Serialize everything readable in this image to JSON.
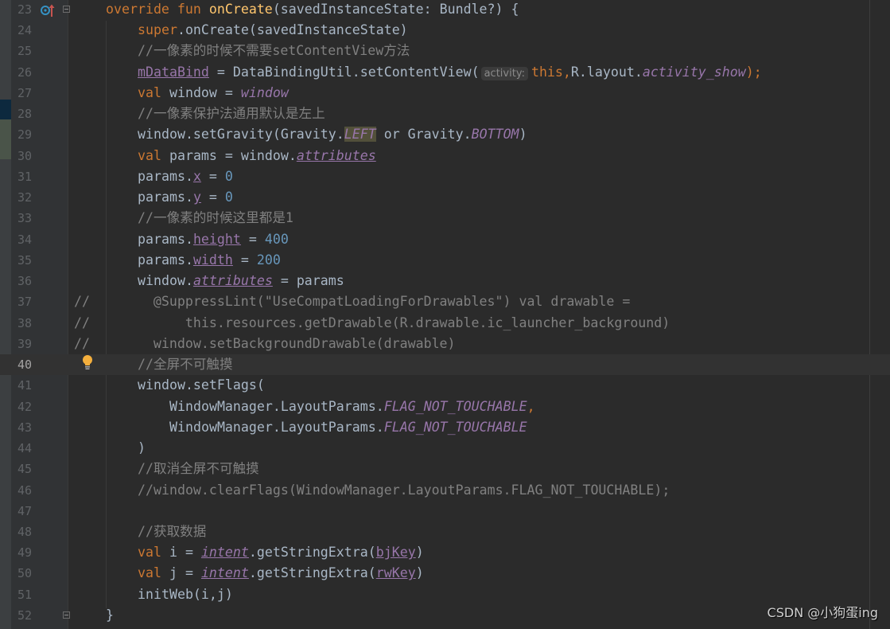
{
  "editor": {
    "colors": {
      "background": "#2b2b2b",
      "gutter": "#313335",
      "keyword": "#cc7832",
      "identifier": "#a9b7c6",
      "comment": "#808080",
      "number": "#6897bb",
      "property": "#9876aa"
    },
    "current_line": 40,
    "lines": [
      {
        "num": "23",
        "indent": 4,
        "tokens": [
          {
            "t": "override fun ",
            "c": "k"
          },
          {
            "t": "onCreate",
            "c": "fn"
          },
          {
            "t": "(savedInstanceState: Bundle?) {",
            "c": "p"
          }
        ]
      },
      {
        "num": "24",
        "indent": 8,
        "tokens": [
          {
            "t": "super",
            "c": "k"
          },
          {
            "t": ".onCreate(savedInstanceState)",
            "c": "p"
          }
        ]
      },
      {
        "num": "25",
        "indent": 8,
        "tokens": [
          {
            "t": "//一像素的时候不需要setContentView方法",
            "c": "c"
          }
        ]
      },
      {
        "num": "26",
        "indent": 8,
        "tokens": [
          {
            "t": "mDataBind",
            "c": "vu"
          },
          {
            "t": " = DataBindingUtil.setContentView(",
            "c": "p"
          },
          {
            "t": "activity:",
            "c": "hint"
          },
          {
            "t": "this,",
            "c": "k"
          },
          {
            "t": "R.layout.",
            "c": "p"
          },
          {
            "t": "activity_show",
            "c": "vi"
          },
          {
            "t": ");",
            "c": "k"
          }
        ]
      },
      {
        "num": "27",
        "indent": 8,
        "tokens": [
          {
            "t": "val ",
            "c": "k"
          },
          {
            "t": "window = ",
            "c": "p"
          },
          {
            "t": "window",
            "c": "vi"
          }
        ]
      },
      {
        "num": "28",
        "indent": 8,
        "tokens": [
          {
            "t": "//一像素保护法通用默认是左上",
            "c": "c"
          }
        ]
      },
      {
        "num": "29",
        "indent": 8,
        "tokens": [
          {
            "t": "window.setGravity(Gravity.",
            "c": "p"
          },
          {
            "t": "LEFT",
            "c": "hl"
          },
          {
            "t": " or Gravity.",
            "c": "p"
          },
          {
            "t": "BOTTOM",
            "c": "vi"
          },
          {
            "t": ")",
            "c": "p"
          }
        ]
      },
      {
        "num": "30",
        "indent": 8,
        "tokens": [
          {
            "t": "val ",
            "c": "k"
          },
          {
            "t": "params = window.",
            "c": "p"
          },
          {
            "t": "attributes",
            "c": "viu"
          }
        ]
      },
      {
        "num": "31",
        "indent": 8,
        "tokens": [
          {
            "t": "params.",
            "c": "p"
          },
          {
            "t": "x",
            "c": "vu"
          },
          {
            "t": " = ",
            "c": "p"
          },
          {
            "t": "0",
            "c": "n"
          }
        ]
      },
      {
        "num": "32",
        "indent": 8,
        "tokens": [
          {
            "t": "params.",
            "c": "p"
          },
          {
            "t": "y",
            "c": "vu"
          },
          {
            "t": " = ",
            "c": "p"
          },
          {
            "t": "0",
            "c": "n"
          }
        ]
      },
      {
        "num": "33",
        "indent": 8,
        "tokens": [
          {
            "t": "//一像素的时候这里都是1",
            "c": "c"
          }
        ]
      },
      {
        "num": "34",
        "indent": 8,
        "tokens": [
          {
            "t": "params.",
            "c": "p"
          },
          {
            "t": "height",
            "c": "vu"
          },
          {
            "t": " = ",
            "c": "p"
          },
          {
            "t": "400",
            "c": "n"
          }
        ]
      },
      {
        "num": "35",
        "indent": 8,
        "tokens": [
          {
            "t": "params.",
            "c": "p"
          },
          {
            "t": "width",
            "c": "vu"
          },
          {
            "t": " = ",
            "c": "p"
          },
          {
            "t": "200",
            "c": "n"
          }
        ]
      },
      {
        "num": "36",
        "indent": 8,
        "tokens": [
          {
            "t": "window.",
            "c": "p"
          },
          {
            "t": "attributes",
            "c": "viu"
          },
          {
            "t": " = params",
            "c": "p"
          }
        ]
      },
      {
        "num": "37",
        "indent": 0,
        "tokens": [
          {
            "t": "//        @SuppressLint(\"UseCompatLoadingForDrawables\") val drawable =",
            "c": "c"
          }
        ]
      },
      {
        "num": "38",
        "indent": 0,
        "tokens": [
          {
            "t": "//            this.resources.getDrawable(R.drawable.ic_launcher_background)",
            "c": "c"
          }
        ]
      },
      {
        "num": "39",
        "indent": 0,
        "tokens": [
          {
            "t": "//        window.setBackgroundDrawable(drawable)",
            "c": "c"
          }
        ]
      },
      {
        "num": "40",
        "indent": 8,
        "tokens": [
          {
            "t": "//全屏不可触摸",
            "c": "c"
          }
        ]
      },
      {
        "num": "41",
        "indent": 8,
        "tokens": [
          {
            "t": "window.setFlags(",
            "c": "p"
          }
        ]
      },
      {
        "num": "42",
        "indent": 12,
        "tokens": [
          {
            "t": "WindowManager.LayoutParams.",
            "c": "p"
          },
          {
            "t": "FLAG_NOT_TOUCHABLE",
            "c": "vi"
          },
          {
            "t": ",",
            "c": "k"
          }
        ]
      },
      {
        "num": "43",
        "indent": 12,
        "tokens": [
          {
            "t": "WindowManager.LayoutParams.",
            "c": "p"
          },
          {
            "t": "FLAG_NOT_TOUCHABLE",
            "c": "vi"
          }
        ]
      },
      {
        "num": "44",
        "indent": 8,
        "tokens": [
          {
            "t": ")",
            "c": "p"
          }
        ]
      },
      {
        "num": "45",
        "indent": 8,
        "tokens": [
          {
            "t": "//取消全屏不可触摸",
            "c": "c"
          }
        ]
      },
      {
        "num": "46",
        "indent": 8,
        "tokens": [
          {
            "t": "//window.clearFlags(WindowManager.LayoutParams.FLAG_NOT_TOUCHABLE);",
            "c": "c"
          }
        ]
      },
      {
        "num": "47",
        "indent": 8,
        "tokens": []
      },
      {
        "num": "48",
        "indent": 8,
        "tokens": [
          {
            "t": "//获取数据",
            "c": "c"
          }
        ]
      },
      {
        "num": "49",
        "indent": 8,
        "tokens": [
          {
            "t": "val ",
            "c": "k"
          },
          {
            "t": "i = ",
            "c": "p"
          },
          {
            "t": "intent",
            "c": "viu"
          },
          {
            "t": ".getStringExtra(",
            "c": "p"
          },
          {
            "t": "bjKey",
            "c": "vu"
          },
          {
            "t": ")",
            "c": "p"
          }
        ]
      },
      {
        "num": "50",
        "indent": 8,
        "tokens": [
          {
            "t": "val ",
            "c": "k"
          },
          {
            "t": "j = ",
            "c": "p"
          },
          {
            "t": "intent",
            "c": "viu"
          },
          {
            "t": ".getStringExtra(",
            "c": "p"
          },
          {
            "t": "rwKey",
            "c": "vu"
          },
          {
            "t": ")",
            "c": "p"
          }
        ]
      },
      {
        "num": "51",
        "indent": 8,
        "tokens": [
          {
            "t": "initWeb(i,j)",
            "c": "p"
          }
        ]
      },
      {
        "num": "52",
        "indent": 4,
        "tokens": [
          {
            "t": "}",
            "c": "p"
          }
        ]
      }
    ],
    "gutter_icons": {
      "line_23": "override-method-icon",
      "line_40": "lightbulb-intention-icon"
    }
  },
  "watermark": "CSDN @小狗蛋ing"
}
